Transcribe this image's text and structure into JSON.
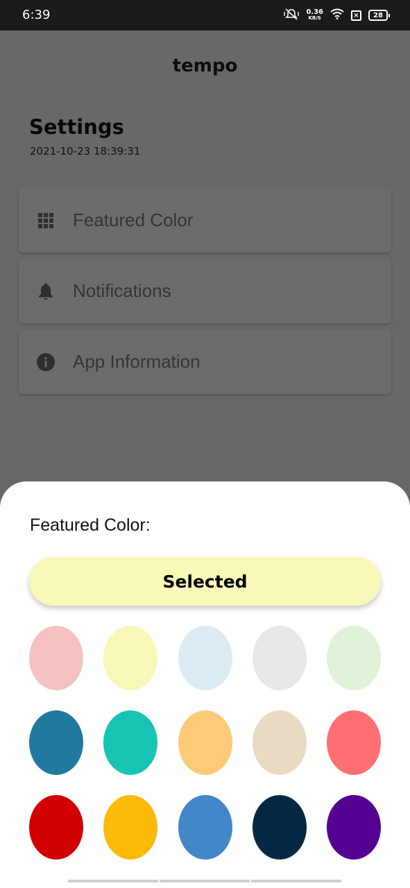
{
  "status_bar": {
    "time": "6:39",
    "net_speed_value": "0.36",
    "net_speed_unit": "KB/S",
    "sim_status": "×",
    "battery": "28",
    "icons": [
      "mute-vibrate-icon",
      "wifi-icon",
      "sim-off-icon",
      "battery-icon"
    ]
  },
  "app": {
    "title": "tempo",
    "page_title": "Settings",
    "timestamp": "2021-10-23 18:39:31"
  },
  "settings": {
    "items": [
      {
        "label": "Featured Color",
        "icon": "grid-icon"
      },
      {
        "label": "Notifications",
        "icon": "bell-icon"
      },
      {
        "label": "App Information",
        "icon": "info-icon"
      }
    ]
  },
  "sheet": {
    "title": "Featured Color:",
    "selected_label": "Selected",
    "selected_color": "#f8f9b8",
    "swatches": [
      "#f4c2c2",
      "#f8f9b8",
      "#ddecf4",
      "#e8e8e8",
      "#e0f2d8",
      "#207aa0",
      "#17c4b4",
      "#fdcb78",
      "#e7dbc3",
      "#fe6f73",
      "#d10001",
      "#fdba0b",
      "#4287c7",
      "#052945",
      "#540091"
    ]
  },
  "colors": {
    "overlay_bg": "#686868",
    "status_bar_bg": "#1b1b1b",
    "sheet_bg": "#ffffff"
  }
}
